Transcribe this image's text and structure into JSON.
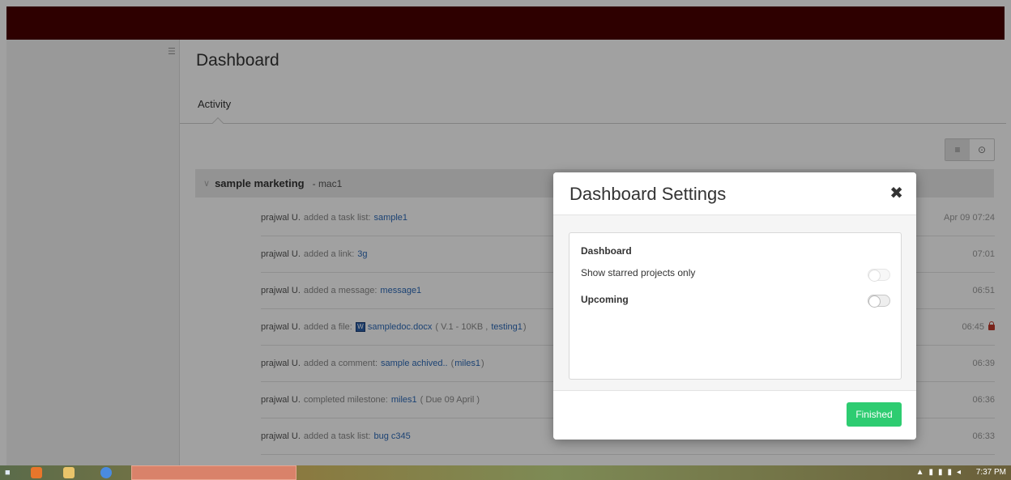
{
  "sidebar": {
    "toggle_icon": "menu-lines-icon"
  },
  "page": {
    "title": "Dashboard"
  },
  "tabs": [
    {
      "label": "Activity"
    }
  ],
  "group": {
    "name": "sample marketing",
    "sub": "- mac1"
  },
  "activity": [
    {
      "who": "prajwal U.",
      "action": "added a task list:",
      "link": "sample1",
      "meta": "",
      "time": "Apr 09 07:24"
    },
    {
      "who": "prajwal U.",
      "action": "added a link:",
      "link": "3g",
      "meta": "",
      "time": "07:01"
    },
    {
      "who": "prajwal U.",
      "action": "added a message:",
      "link": "message1",
      "meta": "",
      "time": "06:51"
    },
    {
      "who": "prajwal U.",
      "action": "added a file:",
      "link": "sampledoc.docx",
      "meta": "( V.1 - 10KB ,",
      "meta_link": "testing1",
      "meta_end": ")",
      "time": "06:45",
      "locked": true
    },
    {
      "who": "prajwal U.",
      "action": "added a comment:",
      "link": "sample achived..",
      "meta": "(",
      "meta_link": "miles1",
      "meta_end": ")",
      "time": "06:39"
    },
    {
      "who": "prajwal U.",
      "action": "completed milestone:",
      "link": "miles1",
      "meta": "( Due 09 April )",
      "time": "06:36"
    },
    {
      "who": "prajwal U.",
      "action": "added a task list:",
      "link": "bug c345",
      "meta": "",
      "time": "06:33"
    }
  ],
  "modal": {
    "title": "Dashboard Settings",
    "section_title": "Dashboard",
    "setting_starred": "Show starred projects only",
    "setting_upcoming": "Upcoming",
    "finished_label": "Finished"
  },
  "taskbar": {
    "clock": "7:37 PM"
  },
  "colors": {
    "topbar": "#4a0000",
    "accent_button": "#2ecc71",
    "link": "#2d6ab8"
  }
}
